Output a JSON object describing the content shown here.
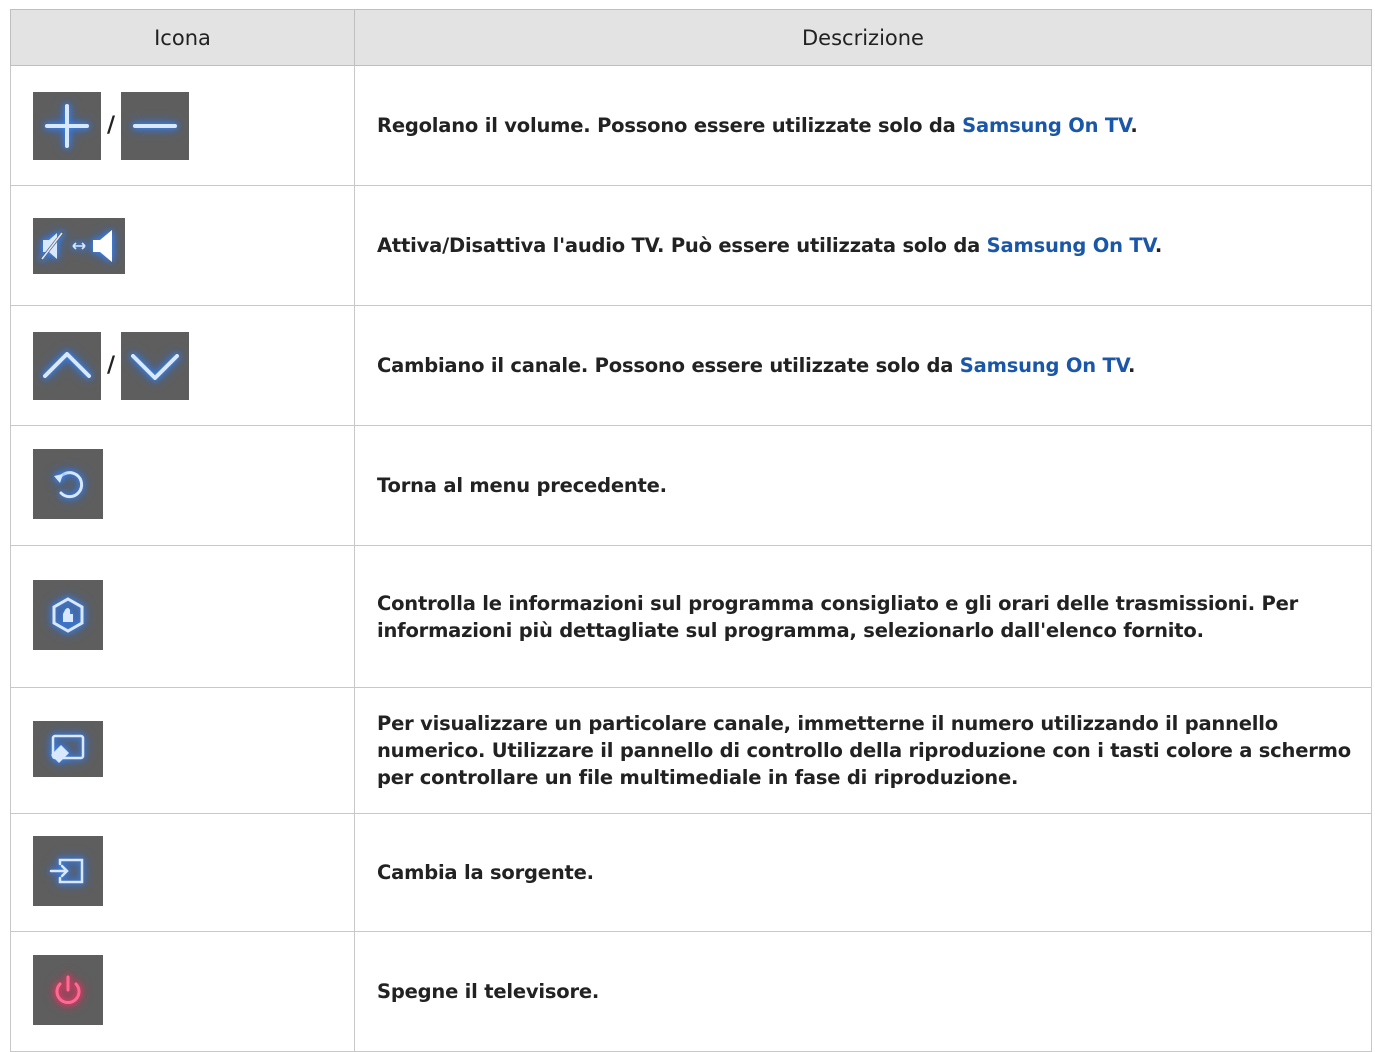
{
  "header": {
    "col_icon": "Icona",
    "col_desc": "Descrizione"
  },
  "separator": "/",
  "rows": [
    {
      "icons": [
        "plus-icon",
        "minus-icon"
      ],
      "text_before": "Regolano il volume. Possono essere utilizzate solo da ",
      "highlight": "Samsung On TV",
      "text_after": "."
    },
    {
      "icons": [
        "mute-toggle-icon"
      ],
      "text_before": "Attiva/Disattiva l'audio TV. Può essere utilizzata solo da ",
      "highlight": "Samsung On TV",
      "text_after": "."
    },
    {
      "icons": [
        "chevron-up-icon",
        "chevron-down-icon"
      ],
      "text_before": "Cambiano il canale. Possono essere utilizzate solo da ",
      "highlight": "Samsung On TV",
      "text_after": "."
    },
    {
      "icons": [
        "return-icon"
      ],
      "text": "Torna al menu precedente."
    },
    {
      "icons": [
        "recommended-icon"
      ],
      "text": "Controlla le informazioni sul programma consigliato e gli orari delle trasmissioni. Per informazioni più dettagliate sul programma, selezionarlo dall'elenco fornito."
    },
    {
      "icons": [
        "remote-panel-icon"
      ],
      "text": "Per visualizzare un particolare canale, immetterne il numero utilizzando il pannello numerico. Utilizzare il pannello di controllo della riproduzione con i tasti colore a schermo per controllare un file multimediale in fase di riproduzione."
    },
    {
      "icons": [
        "source-icon"
      ],
      "text": "Cambia la sorgente."
    },
    {
      "icons": [
        "power-icon"
      ],
      "text": "Spegne il televisore."
    }
  ],
  "colors": {
    "accent": "#1b57a8",
    "tile": "#5e5e5e",
    "icon_blue": "#cfe3ff",
    "icon_red": "#ff5a8a",
    "header_bg": "#e3e3e3"
  }
}
